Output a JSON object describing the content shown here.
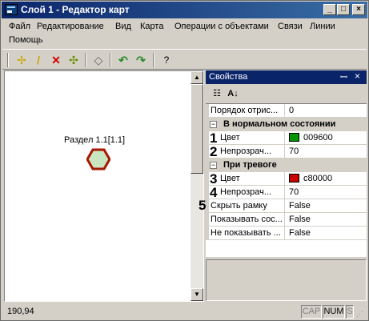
{
  "window": {
    "title": "Слой 1 - Редактор карт",
    "controls": {
      "minimize": "_",
      "maximize": "□",
      "close": "×"
    }
  },
  "menu": {
    "items": [
      "Файл",
      "Редактирование",
      "Вид",
      "Карта",
      "Операции с объектами",
      "Связи",
      "Линии",
      "Помощь"
    ]
  },
  "toolbar": {
    "buttons": [
      {
        "icon": "add-point-icon",
        "glyph": "✢"
      },
      {
        "icon": "pencil-icon",
        "glyph": "/"
      },
      {
        "icon": "delete-icon",
        "glyph": "✕"
      },
      {
        "icon": "move-icon",
        "glyph": "✣"
      },
      {
        "icon": "eraser-icon",
        "glyph": "◇"
      },
      {
        "icon": "undo-icon",
        "glyph": "↶"
      },
      {
        "icon": "redo-icon",
        "glyph": "↷"
      },
      {
        "icon": "help-icon",
        "glyph": "?"
      }
    ]
  },
  "map": {
    "object_label": "Раздел 1.1[1.1]",
    "object_fill": "#c8e6c0",
    "object_border": "#c80000"
  },
  "properties": {
    "title": "Свойства",
    "pin": "ꟷ",
    "close": "×",
    "tools": {
      "categorized": "☷",
      "sorted": "A↓"
    },
    "rows": [
      {
        "name": "Порядок отрис...",
        "value": "0"
      },
      {
        "category": "В нормальном состоянии",
        "expander": "⊟"
      },
      {
        "name": "Цвет",
        "value": "009600",
        "swatch": "#009600",
        "marker": "1"
      },
      {
        "name": "Непрозрач...",
        "value": "70",
        "marker": "2"
      },
      {
        "category": "При тревоге",
        "expander": "⊟"
      },
      {
        "name": "Цвет",
        "value": "c80000",
        "swatch": "#c80000",
        "marker": "3"
      },
      {
        "name": "Непрозрач...",
        "value": "70",
        "marker": "4"
      },
      {
        "name": "Скрыть рамку",
        "value": "False",
        "marker": "5"
      },
      {
        "name": "Показывать сос...",
        "value": "False"
      },
      {
        "name": "Не показывать ...",
        "value": "False"
      }
    ]
  },
  "statusbar": {
    "coords": "190,94",
    "indicators": [
      "CAP",
      "NUM",
      "S"
    ]
  },
  "colors": {
    "titlebar_start": "#0a246a",
    "titlebar_end": "#3a6ea5",
    "normal_color": "#009600",
    "alarm_color": "#c80000"
  }
}
